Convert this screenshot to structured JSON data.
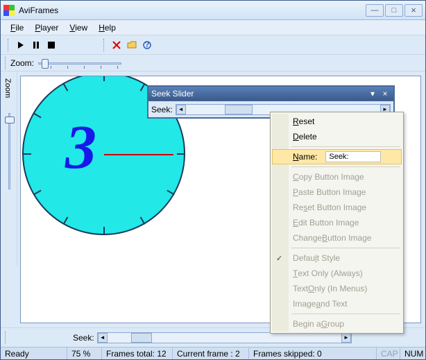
{
  "app": {
    "title": "AviFrames"
  },
  "menu": {
    "file": "File",
    "player": "Player",
    "view": "View",
    "help": "Help"
  },
  "zoom": {
    "label": "Zoom:",
    "vertical_label": "Zoom"
  },
  "seek_window": {
    "title": "Seek Slider",
    "label": "Seek:"
  },
  "context_menu": {
    "reset": "Reset",
    "delete": "Delete",
    "name_label": "Name:",
    "name_value": "Seek:",
    "copy_img": "Copy Button Image",
    "paste_img": "Paste Button Image",
    "reset_img": "Reset Button Image",
    "edit_img": "Edit Button Image",
    "change_img": "Change Button Image",
    "default_style": "Default Style",
    "text_only_always": "Text Only (Always)",
    "text_only_menus": "Text Only (In Menus)",
    "image_and_text": "Image and Text",
    "begin_group": "Begin a Group"
  },
  "bottom_seek": {
    "label": "Seek:"
  },
  "status": {
    "ready": "Ready",
    "zoom": "75 %",
    "frames_total": "Frames total:  12",
    "current_frame": "Current frame :  2",
    "frames_skipped": "Frames skipped:  0",
    "cap": "CAP",
    "num": "NUM"
  },
  "clock_digit": "3"
}
